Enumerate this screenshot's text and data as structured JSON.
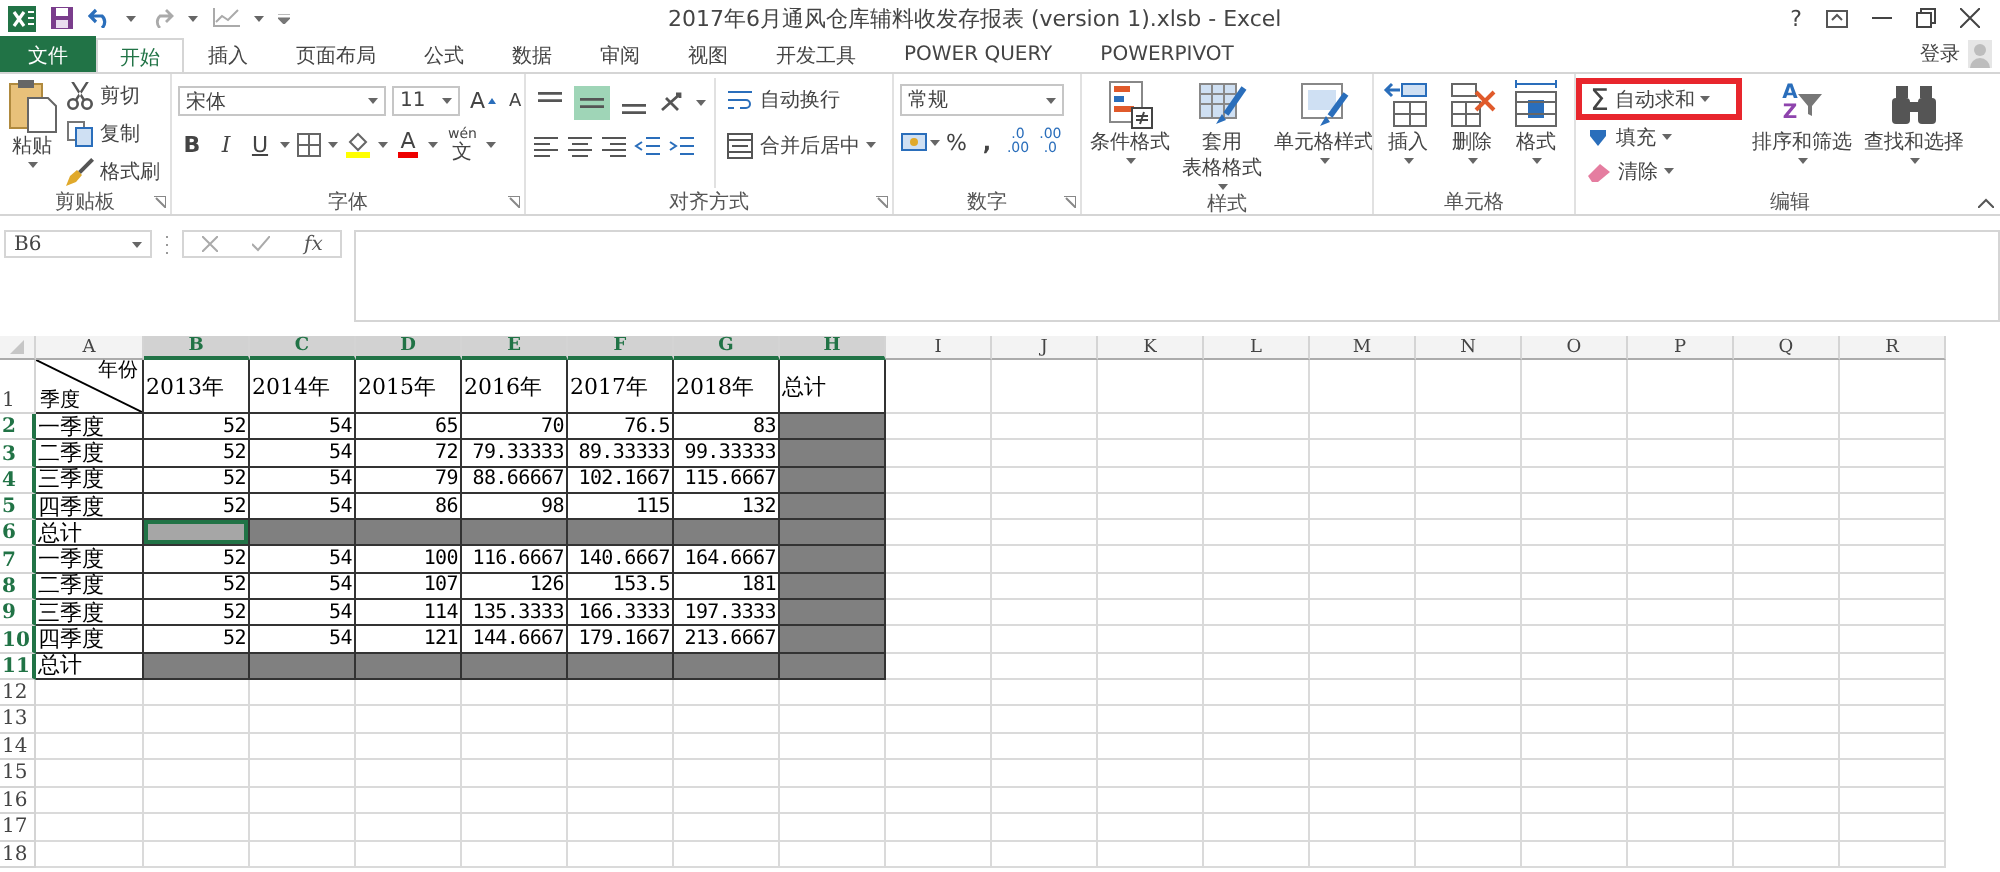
{
  "window": {
    "title": "2017年6月通风仓库辅料收发存报表 (version 1).xlsb - Excel",
    "help": "?"
  },
  "tabs": [
    {
      "label": "文件",
      "kind": "file",
      "selected": false
    },
    {
      "label": "开始",
      "kind": "tab",
      "selected": true
    },
    {
      "label": "插入",
      "kind": "tab",
      "selected": false
    },
    {
      "label": "页面布局",
      "kind": "tab",
      "selected": false
    },
    {
      "label": "公式",
      "kind": "tab",
      "selected": false
    },
    {
      "label": "数据",
      "kind": "tab",
      "selected": false
    },
    {
      "label": "审阅",
      "kind": "tab",
      "selected": false
    },
    {
      "label": "视图",
      "kind": "tab",
      "selected": false
    },
    {
      "label": "开发工具",
      "kind": "tab",
      "selected": false
    },
    {
      "label": "POWER QUERY",
      "kind": "tab",
      "selected": false
    },
    {
      "label": "POWERPIVOT",
      "kind": "tab",
      "selected": false
    }
  ],
  "account": {
    "label": "登录"
  },
  "ribbon": {
    "groups": [
      {
        "kind": "clipboard",
        "label": "剪贴板",
        "paste": "粘贴",
        "items": [
          {
            "kind": "cut",
            "label": "剪切"
          },
          {
            "kind": "copy",
            "label": "复制"
          },
          {
            "kind": "painter",
            "label": "格式刷"
          }
        ]
      },
      {
        "kind": "font",
        "label": "字体",
        "font_name": "宋体",
        "font_size": "11",
        "grow": "A",
        "shrink": "A",
        "styles": [
          {
            "kind": "bold",
            "label": "B"
          },
          {
            "kind": "italic",
            "label": "I"
          },
          {
            "kind": "underline",
            "label": "U"
          }
        ],
        "font_color": "A",
        "phonetic": {
          "top": "wén",
          "bottom": "文"
        }
      },
      {
        "kind": "alignment",
        "label": "对齐方式",
        "vertical_align": [
          {
            "kind": "top",
            "selected": false
          },
          {
            "kind": "middle",
            "selected": true
          },
          {
            "kind": "bottom",
            "selected": false
          }
        ],
        "wrap": "自动换行",
        "merge": "合并后居中"
      },
      {
        "kind": "number",
        "label": "数字",
        "format": "常规",
        "percent": "%",
        "comma": ",",
        "increase_decimal": [
          ".0",
          ".00"
        ],
        "decrease_decimal": [
          ".00",
          ".0"
        ]
      },
      {
        "kind": "styles",
        "label": "样式",
        "items": [
          {
            "kind": "conditional",
            "lines": [
              "条件格式"
            ]
          },
          {
            "kind": "table",
            "lines": [
              "套用",
              "表格格式"
            ]
          },
          {
            "kind": "cellstyle",
            "lines": [
              "单元格样式"
            ]
          }
        ]
      },
      {
        "kind": "cells",
        "label": "单元格",
        "items": [
          {
            "kind": "insert",
            "lines": [
              "插入"
            ]
          },
          {
            "kind": "delete",
            "lines": [
              "删除"
            ]
          },
          {
            "kind": "format",
            "lines": [
              "格式"
            ]
          }
        ]
      },
      {
        "kind": "editing",
        "label": "编辑",
        "autosum": {
          "symbol": "Σ",
          "label": "自动求和",
          "highlighted": true
        },
        "fill": "填充",
        "clear": "清除",
        "sort": {
          "letters": [
            "A",
            "Z"
          ],
          "label": "排序和筛选"
        },
        "find": "查找和选择"
      }
    ]
  },
  "formula_bar": {
    "name_box": "B6",
    "fx": "fx"
  },
  "sheet": {
    "columns": [
      {
        "label": "A",
        "selected": false
      },
      {
        "label": "B",
        "selected": true
      },
      {
        "label": "C",
        "selected": true
      },
      {
        "label": "D",
        "selected": true
      },
      {
        "label": "E",
        "selected": true
      },
      {
        "label": "F",
        "selected": true
      },
      {
        "label": "G",
        "selected": true
      },
      {
        "label": "H",
        "selected": true
      },
      {
        "label": "I",
        "selected": false
      },
      {
        "label": "J",
        "selected": false
      },
      {
        "label": "K",
        "selected": false
      },
      {
        "label": "L",
        "selected": false
      },
      {
        "label": "M",
        "selected": false
      },
      {
        "label": "N",
        "selected": false
      },
      {
        "label": "O",
        "selected": false
      },
      {
        "label": "P",
        "selected": false
      },
      {
        "label": "Q",
        "selected": false
      },
      {
        "label": "R",
        "selected": false
      }
    ],
    "rows": [
      {
        "number": "1",
        "selected": false,
        "cells": [
          {
            "kind": "diagonal",
            "top": "年份",
            "bottom": "季度",
            "shaded": false,
            "active": false
          },
          {
            "kind": "label",
            "text": "2013年",
            "shaded": false,
            "active": false
          },
          {
            "kind": "label",
            "text": "2014年",
            "shaded": false,
            "active": false
          },
          {
            "kind": "label",
            "text": "2015年",
            "shaded": false,
            "active": false
          },
          {
            "kind": "label",
            "text": "2016年",
            "shaded": false,
            "active": false
          },
          {
            "kind": "label",
            "text": "2017年",
            "shaded": false,
            "active": false
          },
          {
            "kind": "label",
            "text": "2018年",
            "shaded": false,
            "active": false
          },
          {
            "kind": "label",
            "text": "总计",
            "shaded": false,
            "active": false
          }
        ]
      },
      {
        "number": "2",
        "selected": true,
        "cells": [
          {
            "kind": "label",
            "text": "一季度",
            "shaded": false,
            "active": false
          },
          {
            "kind": "number",
            "text": "52",
            "shaded": false,
            "active": false
          },
          {
            "kind": "number",
            "text": "54",
            "shaded": false,
            "active": false
          },
          {
            "kind": "number",
            "text": "65",
            "shaded": false,
            "active": false
          },
          {
            "kind": "number",
            "text": "70",
            "shaded": false,
            "active": false
          },
          {
            "kind": "number",
            "text": "76.5",
            "shaded": false,
            "active": false
          },
          {
            "kind": "number",
            "text": "83",
            "shaded": false,
            "active": false
          },
          {
            "kind": "blank",
            "shaded": true,
            "active": false
          }
        ]
      },
      {
        "number": "3",
        "selected": true,
        "cells": [
          {
            "kind": "label",
            "text": "二季度",
            "shaded": false,
            "active": false
          },
          {
            "kind": "number",
            "text": "52",
            "shaded": false,
            "active": false
          },
          {
            "kind": "number",
            "text": "54",
            "shaded": false,
            "active": false
          },
          {
            "kind": "number",
            "text": "72",
            "shaded": false,
            "active": false
          },
          {
            "kind": "number",
            "text": "79.33333",
            "shaded": false,
            "active": false
          },
          {
            "kind": "number",
            "text": "89.33333",
            "shaded": false,
            "active": false
          },
          {
            "kind": "number",
            "text": "99.33333",
            "shaded": false,
            "active": false
          },
          {
            "kind": "blank",
            "shaded": true,
            "active": false
          }
        ]
      },
      {
        "number": "4",
        "selected": true,
        "cells": [
          {
            "kind": "label",
            "text": "三季度",
            "shaded": false,
            "active": false
          },
          {
            "kind": "number",
            "text": "52",
            "shaded": false,
            "active": false
          },
          {
            "kind": "number",
            "text": "54",
            "shaded": false,
            "active": false
          },
          {
            "kind": "number",
            "text": "79",
            "shaded": false,
            "active": false
          },
          {
            "kind": "number",
            "text": "88.66667",
            "shaded": false,
            "active": false
          },
          {
            "kind": "number",
            "text": "102.1667",
            "shaded": false,
            "active": false
          },
          {
            "kind": "number",
            "text": "115.6667",
            "shaded": false,
            "active": false
          },
          {
            "kind": "blank",
            "shaded": true,
            "active": false
          }
        ]
      },
      {
        "number": "5",
        "selected": true,
        "cells": [
          {
            "kind": "label",
            "text": "四季度",
            "shaded": false,
            "active": false
          },
          {
            "kind": "number",
            "text": "52",
            "shaded": false,
            "active": false
          },
          {
            "kind": "number",
            "text": "54",
            "shaded": false,
            "active": false
          },
          {
            "kind": "number",
            "text": "86",
            "shaded": false,
            "active": false
          },
          {
            "kind": "number",
            "text": "98",
            "shaded": false,
            "active": false
          },
          {
            "kind": "number",
            "text": "115",
            "shaded": false,
            "active": false
          },
          {
            "kind": "number",
            "text": "132",
            "shaded": false,
            "active": false
          },
          {
            "kind": "blank",
            "shaded": true,
            "active": false
          }
        ]
      },
      {
        "number": "6",
        "selected": true,
        "cells": [
          {
            "kind": "label",
            "text": "总计",
            "shaded": false,
            "active": false
          },
          {
            "kind": "blank",
            "shaded": true,
            "active": true
          },
          {
            "kind": "blank",
            "shaded": true,
            "active": false
          },
          {
            "kind": "blank",
            "shaded": true,
            "active": false
          },
          {
            "kind": "blank",
            "shaded": true,
            "active": false
          },
          {
            "kind": "blank",
            "shaded": true,
            "active": false
          },
          {
            "kind": "blank",
            "shaded": true,
            "active": false
          },
          {
            "kind": "blank",
            "shaded": true,
            "active": false
          }
        ]
      },
      {
        "number": "7",
        "selected": true,
        "cells": [
          {
            "kind": "label",
            "text": "一季度",
            "shaded": false,
            "active": false
          },
          {
            "kind": "number",
            "text": "52",
            "shaded": false,
            "active": false
          },
          {
            "kind": "number",
            "text": "54",
            "shaded": false,
            "active": false
          },
          {
            "kind": "number",
            "text": "100",
            "shaded": false,
            "active": false
          },
          {
            "kind": "number",
            "text": "116.6667",
            "shaded": false,
            "active": false
          },
          {
            "kind": "number",
            "text": "140.6667",
            "shaded": false,
            "active": false
          },
          {
            "kind": "number",
            "text": "164.6667",
            "shaded": false,
            "active": false
          },
          {
            "kind": "blank",
            "shaded": true,
            "active": false
          }
        ]
      },
      {
        "number": "8",
        "selected": true,
        "cells": [
          {
            "kind": "label",
            "text": "二季度",
            "shaded": false,
            "active": false
          },
          {
            "kind": "number",
            "text": "52",
            "shaded": false,
            "active": false
          },
          {
            "kind": "number",
            "text": "54",
            "shaded": false,
            "active": false
          },
          {
            "kind": "number",
            "text": "107",
            "shaded": false,
            "active": false
          },
          {
            "kind": "number",
            "text": "126",
            "shaded": false,
            "active": false
          },
          {
            "kind": "number",
            "text": "153.5",
            "shaded": false,
            "active": false
          },
          {
            "kind": "number",
            "text": "181",
            "shaded": false,
            "active": false
          },
          {
            "kind": "blank",
            "shaded": true,
            "active": false
          }
        ]
      },
      {
        "number": "9",
        "selected": true,
        "cells": [
          {
            "kind": "label",
            "text": "三季度",
            "shaded": false,
            "active": false
          },
          {
            "kind": "number",
            "text": "52",
            "shaded": false,
            "active": false
          },
          {
            "kind": "number",
            "text": "54",
            "shaded": false,
            "active": false
          },
          {
            "kind": "number",
            "text": "114",
            "shaded": false,
            "active": false
          },
          {
            "kind": "number",
            "text": "135.3333",
            "shaded": false,
            "active": false
          },
          {
            "kind": "number",
            "text": "166.3333",
            "shaded": false,
            "active": false
          },
          {
            "kind": "number",
            "text": "197.3333",
            "shaded": false,
            "active": false
          },
          {
            "kind": "blank",
            "shaded": true,
            "active": false
          }
        ]
      },
      {
        "number": "10",
        "selected": true,
        "cells": [
          {
            "kind": "label",
            "text": "四季度",
            "shaded": false,
            "active": false
          },
          {
            "kind": "number",
            "text": "52",
            "shaded": false,
            "active": false
          },
          {
            "kind": "number",
            "text": "54",
            "shaded": false,
            "active": false
          },
          {
            "kind": "number",
            "text": "121",
            "shaded": false,
            "active": false
          },
          {
            "kind": "number",
            "text": "144.6667",
            "shaded": false,
            "active": false
          },
          {
            "kind": "number",
            "text": "179.1667",
            "shaded": false,
            "active": false
          },
          {
            "kind": "number",
            "text": "213.6667",
            "shaded": false,
            "active": false
          },
          {
            "kind": "blank",
            "shaded": true,
            "active": false
          }
        ]
      },
      {
        "number": "11",
        "selected": true,
        "cells": [
          {
            "kind": "label",
            "text": "总计",
            "shaded": false,
            "active": false
          },
          {
            "kind": "blank",
            "shaded": true,
            "active": false
          },
          {
            "kind": "blank",
            "shaded": true,
            "active": false
          },
          {
            "kind": "blank",
            "shaded": true,
            "active": false
          },
          {
            "kind": "blank",
            "shaded": true,
            "active": false
          },
          {
            "kind": "blank",
            "shaded": true,
            "active": false
          },
          {
            "kind": "blank",
            "shaded": true,
            "active": false
          },
          {
            "kind": "blank",
            "shaded": true,
            "active": false
          }
        ]
      }
    ],
    "empty_rows": [
      {
        "number": "12"
      },
      {
        "number": "13"
      },
      {
        "number": "14"
      },
      {
        "number": "15"
      },
      {
        "number": "16"
      },
      {
        "number": "17"
      },
      {
        "number": "18"
      }
    ]
  }
}
